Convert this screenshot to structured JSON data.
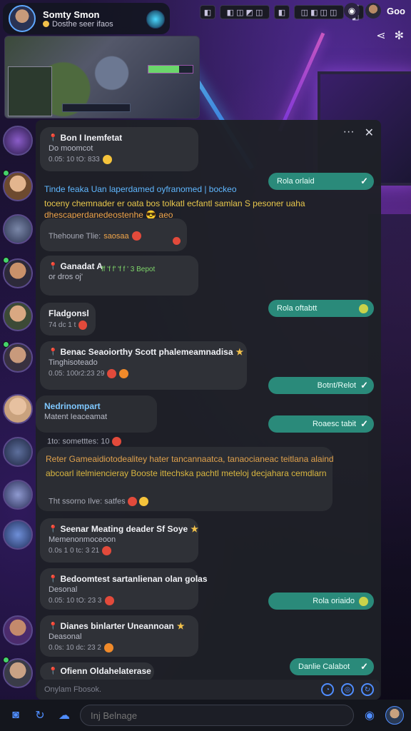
{
  "header": {
    "contact_name": "Somty Smon",
    "contact_status": "Dosthe seer ifaos",
    "top_chips": [
      "◧",
      "◧ ◫ ◩ ◫",
      "◧",
      "◫ ◧ ◫ ◫",
      "◫ ◧"
    ],
    "top_right_label": "Goo",
    "share_icons": [
      "share-icon",
      "settings-icon"
    ]
  },
  "chat": {
    "menu_label": "···",
    "close_label": "✕",
    "messages": [
      {
        "kind": "incoming",
        "title": "Bon I Inemfetat",
        "sub": "Do moomcot",
        "meta": "0.05: 10 tO: 833"
      },
      {
        "kind": "sent",
        "label": "Rola orlaid"
      },
      {
        "kind": "text",
        "lines": [
          {
            "text": "Tinde feaka Uan laperdamed oyfranomed | bockeo",
            "color": "blue"
          },
          {
            "text": "toceny chemnader er oata bos tolkatl ecfantl samlan S pesoner uaha",
            "color": "yellow"
          },
          {
            "text": "dhescaperdanedeostenhe 😎 aeo",
            "color": "orange"
          }
        ]
      },
      {
        "kind": "incoming",
        "title": "Thehoune Tlie: ",
        "sub": "",
        "meta": "",
        "tag": "saosaa"
      },
      {
        "kind": "incoming",
        "title": "Ganadat A",
        "sub": "or dros oj'",
        "meta": "",
        "extra": "ff 'f f' 'f f ' 3 Bepot"
      },
      {
        "kind": "sent",
        "label": "Rola oftabtt"
      },
      {
        "kind": "incoming",
        "title": "Fladgonsl",
        "sub": "",
        "meta": "74 dc 1 t"
      },
      {
        "kind": "incoming",
        "title": "Benac Seaoiorthy Scott phalemeamnadisa",
        "sub": "Tinghisoteado",
        "meta": "0.05: 100r2:23 29"
      },
      {
        "kind": "sent",
        "label": "Botnt/Relot"
      },
      {
        "kind": "incoming",
        "title": "Nedrinompart",
        "sub": "Matent Ieaceamat",
        "meta": ""
      },
      {
        "kind": "sent",
        "label": "Roaesc tabit"
      },
      {
        "kind": "text",
        "lines": [
          {
            "text": "1to: sometttes: 10",
            "color": "grey"
          }
        ]
      },
      {
        "kind": "text",
        "lines": [
          {
            "text": "Reter Gameaidiotodealitey hater tancannaatca, tanaocianeac teitlana alaind",
            "color": "mixed1"
          },
          {
            "text": "abcoarl itelmiencieray  Booste ittechska pachtl meteloj decjahara cemdlarn",
            "color": "mixed2"
          }
        ]
      },
      {
        "kind": "text",
        "lines": [
          {
            "text": "Tht ssorno Ilve: satfes",
            "color": "grey"
          }
        ]
      },
      {
        "kind": "incoming",
        "title": "Seenar Meating deader Sf Soye",
        "sub": "Memenonmoceoon",
        "meta": "0.0s 1 0 tc: 3 21"
      },
      {
        "kind": "incoming",
        "title": "Bedoomtest sartanlienan olan golas",
        "sub": "Desonal",
        "meta": "0.05: 10 tO: 23 3"
      },
      {
        "kind": "sent",
        "label": "Rola oriaido"
      },
      {
        "kind": "incoming",
        "title": "Dianes binlarter Uneannoan",
        "sub": "Deasonal",
        "meta": "0.0s: 10 dc: 23 2"
      },
      {
        "kind": "sent",
        "label": "Danlie Calabot"
      },
      {
        "kind": "incoming",
        "title": "Ofienn Oldahelaterase",
        "sub": "",
        "meta": ""
      }
    ],
    "composer_placeholder": "Onylam Fbosok."
  },
  "bottom_bar": {
    "input_placeholder": "Inj Belnage"
  },
  "colors": {
    "panel": "#1e2026",
    "bubble": "#2f3137",
    "sent": "#2a8a7a",
    "accent_blue": "#4f8dff"
  }
}
